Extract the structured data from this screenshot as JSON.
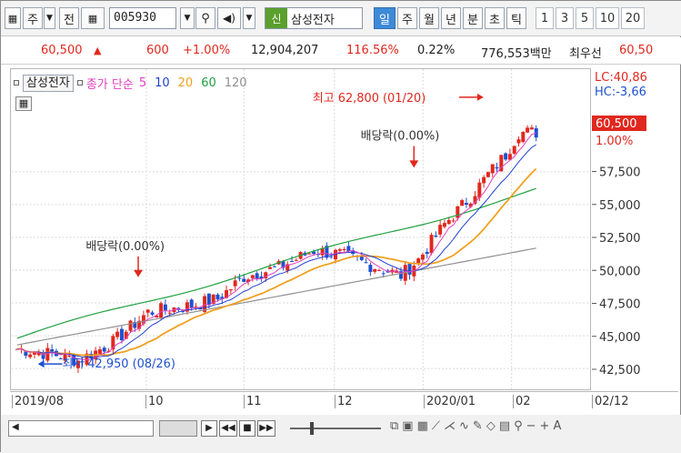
{
  "toolbar": {
    "market_btn": "주",
    "prev_btn": "전",
    "stock_code": "005930",
    "stock_tag": "신",
    "stock_name": "삼성전자",
    "periods": [
      "일",
      "주",
      "월",
      "년",
      "분",
      "초",
      "틱"
    ],
    "active_period": "일",
    "intervals": [
      "1",
      "3",
      "5",
      "10",
      "20"
    ]
  },
  "quote": {
    "price": "60,500",
    "change": "600",
    "change_pct": "+1.00%",
    "volume": "12,904,207",
    "vol_ratio": "116.56%",
    "turnover": "0.22%",
    "amount": "776,553백만",
    "pref_label": "최우선",
    "pref_price": "60,50"
  },
  "legend": {
    "name": "삼성전자",
    "indicator": "종가 단순",
    "periods": [
      "5",
      "10",
      "20",
      "60",
      "120"
    ],
    "period_colors": [
      "#e040c0",
      "#2040d0",
      "#f0a020",
      "#20a040",
      "#909090"
    ]
  },
  "y_right": {
    "lc": "LC:40,86",
    "hc": "HC:-3,66",
    "current": "60,500",
    "current_pct": "1.00%",
    "ticks": [
      "57,500",
      "55,000",
      "52,500",
      "50,000",
      "47,500",
      "45,000",
      "42,500"
    ]
  },
  "x_axis": {
    "labels": [
      "2019/08",
      "10",
      "11",
      "12",
      "2020/01",
      "02",
      "02/12"
    ]
  },
  "annotations": {
    "high": "최고 62,800 (01/20)",
    "low": "최저 42,950 (08/26)",
    "div1": "배당락(0.00%)",
    "div2": "배당락(0.00%)"
  },
  "colors": {
    "up": "#e0281e",
    "down": "#1e50d0",
    "ma5": "#e040c0",
    "ma10": "#2040d0",
    "ma20": "#f0a020",
    "ma60": "#20a040",
    "ma120": "#909090"
  }
}
